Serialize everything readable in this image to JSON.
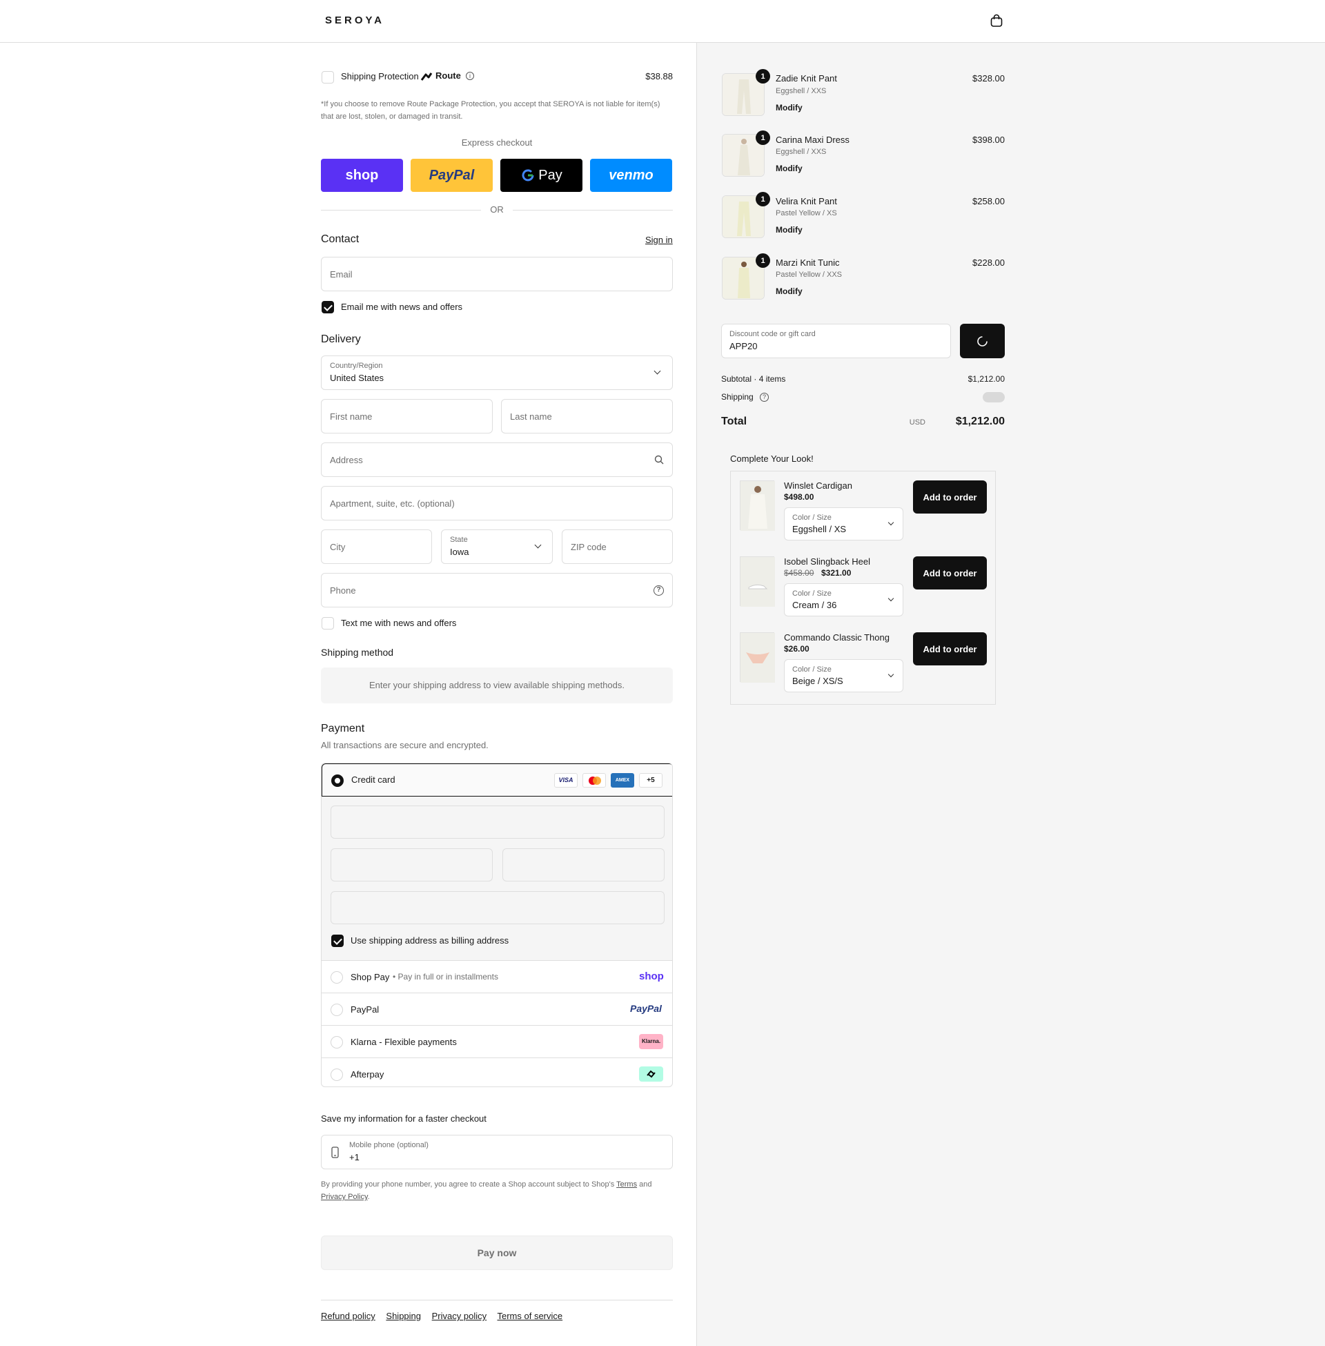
{
  "header": {
    "brand": "SEROYA",
    "cart_icon": "shopping-bag-icon"
  },
  "shipping_protection": {
    "label": "Shipping Protection",
    "provider": "Route",
    "price": "$38.88",
    "disclaimer": "*If you choose to remove Route Package Protection, you accept that SEROYA is not liable for item(s) that are lost, stolen, or damaged in transit."
  },
  "express": {
    "title": "Express checkout",
    "buttons": [
      {
        "label": "shop",
        "color": "#5a31f4"
      },
      {
        "label": "PayPal",
        "color": "#ffc439"
      },
      {
        "label": "Pay",
        "color": "#000000"
      },
      {
        "label": "venmo",
        "color": "#008cff"
      }
    ],
    "divider": "OR"
  },
  "contact": {
    "title": "Contact",
    "sign_in": "Sign in",
    "email_placeholder": "Email",
    "newsletter_label": "Email me with news and offers"
  },
  "delivery": {
    "title": "Delivery",
    "country_label": "Country/Region",
    "country_value": "United States",
    "first_name": "First name",
    "last_name": "Last name",
    "address": "Address",
    "apartment": "Apartment, suite, etc. (optional)",
    "city": "City",
    "state_label": "State",
    "state_value": "Iowa",
    "zip": "ZIP code",
    "phone": "Phone",
    "text_offers": "Text me with news and offers"
  },
  "shipping_method": {
    "title": "Shipping method",
    "message": "Enter your shipping address to view available shipping methods."
  },
  "payment": {
    "title": "Payment",
    "subtitle": "All transactions are secure and encrypted.",
    "credit_card": "Credit card",
    "card_brands": [
      "VISA",
      "",
      "AMEX",
      "+5"
    ],
    "billing_same": "Use shipping address as billing address",
    "shop_pay": "Shop Pay",
    "shop_pay_sub": "Pay in full or in installments",
    "shop_pay_logo": "shop",
    "paypal": "PayPal",
    "paypal_logo": "PayPal",
    "klarna": "Klarna - Flexible payments",
    "klarna_logo": "Klarna.",
    "afterpay": "Afterpay"
  },
  "save_info": {
    "title": "Save my information for a faster checkout",
    "mobile_label": "Mobile phone (optional)",
    "mobile_value": "+1",
    "legal_prefix": "By providing your phone number, you agree to create a Shop account subject to Shop's",
    "terms": "Terms",
    "and": "and",
    "privacy": "Privacy Policy",
    "period": "."
  },
  "pay_now": "Pay now",
  "footer": [
    "Refund policy",
    "Shipping",
    "Privacy policy",
    "Terms of service"
  ],
  "cart": {
    "items": [
      {
        "qty": "1",
        "name": "Zadie Knit Pant",
        "variant": "Eggshell / XXS",
        "modify": "Modify",
        "price": "$328.00"
      },
      {
        "qty": "1",
        "name": "Carina Maxi Dress",
        "variant": "Eggshell / XXS",
        "modify": "Modify",
        "price": "$398.00"
      },
      {
        "qty": "1",
        "name": "Velira Knit Pant",
        "variant": "Pastel Yellow / XS",
        "modify": "Modify",
        "price": "$258.00"
      },
      {
        "qty": "1",
        "name": "Marzi Knit Tunic",
        "variant": "Pastel Yellow / XXS",
        "modify": "Modify",
        "price": "$228.00"
      }
    ],
    "discount_label": "Discount code or gift card",
    "discount_value": "APP20",
    "subtotal_label": "Subtotal · 4 items",
    "subtotal_value": "$1,212.00",
    "shipping_label": "Shipping",
    "total_label": "Total",
    "total_currency": "USD",
    "total_value": "$1,212.00"
  },
  "upsell": {
    "title": "Complete Your Look!",
    "items": [
      {
        "name": "Winslet Cardigan",
        "price": "$498.00",
        "old_price": "",
        "variant_label": "Color / Size",
        "variant_value": "Eggshell / XS",
        "button": "Add to order"
      },
      {
        "name": "Isobel Slingback Heel",
        "price": "$321.00",
        "old_price": "$458.00",
        "variant_label": "Color / Size",
        "variant_value": "Cream / 36",
        "button": "Add to order"
      },
      {
        "name": "Commando Classic Thong",
        "price": "$26.00",
        "old_price": "",
        "variant_label": "Color / Size",
        "variant_value": "Beige / XS/S",
        "button": "Add to order"
      }
    ]
  }
}
